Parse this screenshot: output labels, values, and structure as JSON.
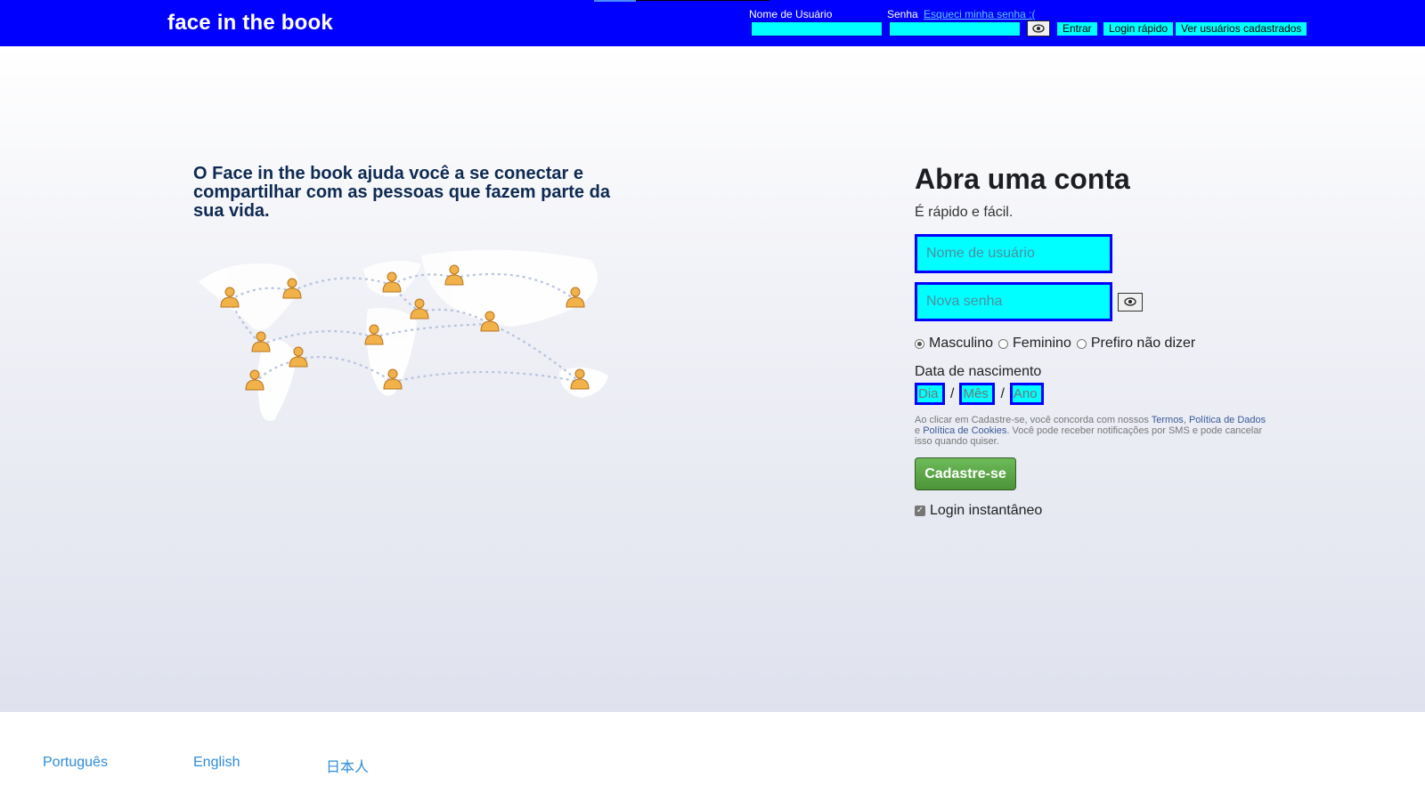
{
  "header": {
    "logo": "face in the book",
    "username_label": "Nome de Usuário",
    "password_label": "Senha",
    "forgot_link": "Esqueci minha senha :(",
    "show_password_icon": "eye-icon",
    "enter_button": "Entrar",
    "quick_login_button": "Login rápido",
    "view_users_button": "Ver usuários cadastrados"
  },
  "main": {
    "tagline": "O Face in the book ajuda você a se conectar e compartilhar com as pessoas que fazem parte da sua vida.",
    "illustration": "world-map-with-people"
  },
  "signup": {
    "title": "Abra uma conta",
    "subtitle": "É rápido e fácil.",
    "username_placeholder": "Nome de usuário",
    "password_placeholder": "Nova senha",
    "genders": [
      "Masculino",
      "Feminino",
      "Prefiro não dizer"
    ],
    "selected_gender": "Masculino",
    "dob_label": "Data de nascimento",
    "dob_day_placeholder": "Dia",
    "dob_month_placeholder": "Mês",
    "dob_year_placeholder": "Ano",
    "dob_separator": "/",
    "terms_prefix": "Ao clicar em Cadastre-se, você concorda com nossos ",
    "terms_link": "Termos",
    "terms_comma": ", ",
    "data_policy_link": "Política de Dados",
    "terms_and": " e ",
    "cookie_policy_link": "Política de Cookies",
    "terms_suffix": ". Você pode receber notificações por SMS e pode cancelar isso quando quiser.",
    "submit_button": "Cadastre-se",
    "instant_login_label": "Login instantâneo",
    "instant_login_checked": true
  },
  "footer": {
    "languages": [
      "Português",
      "English",
      "日本人"
    ]
  },
  "colors": {
    "topbar": "#0000ff",
    "input_fill": "#00ffff",
    "signup_button": "#5aa646",
    "link": "#2d8cdb"
  }
}
